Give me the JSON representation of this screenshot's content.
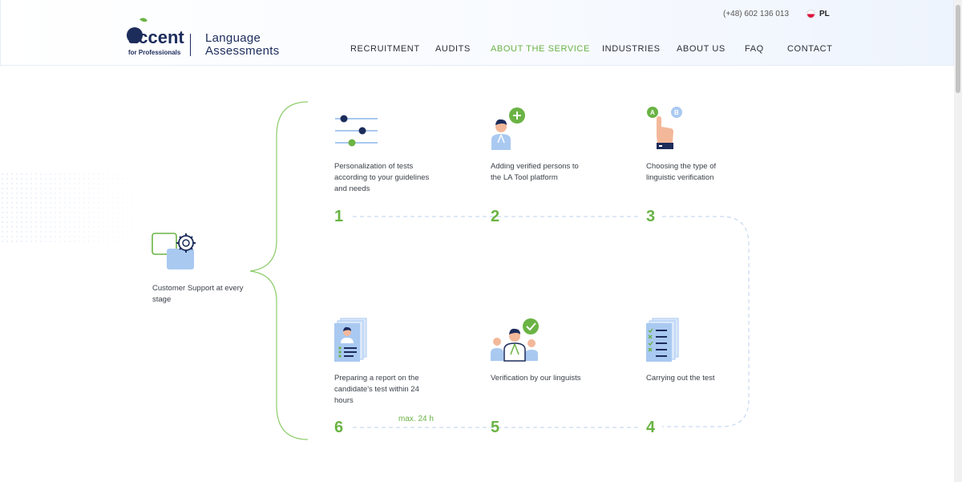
{
  "header": {
    "phone": "(+48) 602 136 013",
    "language": "PL",
    "logo_text": "accent",
    "logo_subtext": "for Professionals",
    "brand_line1": "Language",
    "brand_line2": "Assessments"
  },
  "nav": {
    "items": [
      {
        "label": "RECRUITMENT"
      },
      {
        "label": "AUDITS"
      },
      {
        "label": "ABOUT THE SERVICE"
      },
      {
        "label": "INDUSTRIES"
      },
      {
        "label": "ABOUT US"
      },
      {
        "label": "FAQ"
      },
      {
        "label": "CONTACT"
      }
    ],
    "active": "ABOUT THE SERVICE"
  },
  "support": {
    "label": "Customer Support at every stage"
  },
  "steps": [
    {
      "number": "1",
      "text": "Personalization of tests according to your guidelines and needs",
      "icon": "sliders-icon"
    },
    {
      "number": "2",
      "text": "Adding verified persons to the LA Tool platform",
      "icon": "add-person-icon"
    },
    {
      "number": "3",
      "text": "Choosing the type of linguistic verification",
      "icon": "choose-option-icon"
    },
    {
      "number": "4",
      "text": "Carrying out the test",
      "icon": "checklist-icon"
    },
    {
      "number": "5",
      "text": "Verification by our linguists",
      "icon": "linguists-verified-icon"
    },
    {
      "number": "6",
      "text": "Preparing a report on the candidate's test within 24 hours",
      "icon": "report-icon"
    }
  ],
  "timeline_label": "max. 24 h",
  "colors": {
    "accent": "#6ab344",
    "navy": "#1c2c5b",
    "light_blue": "#a9c9f1"
  }
}
